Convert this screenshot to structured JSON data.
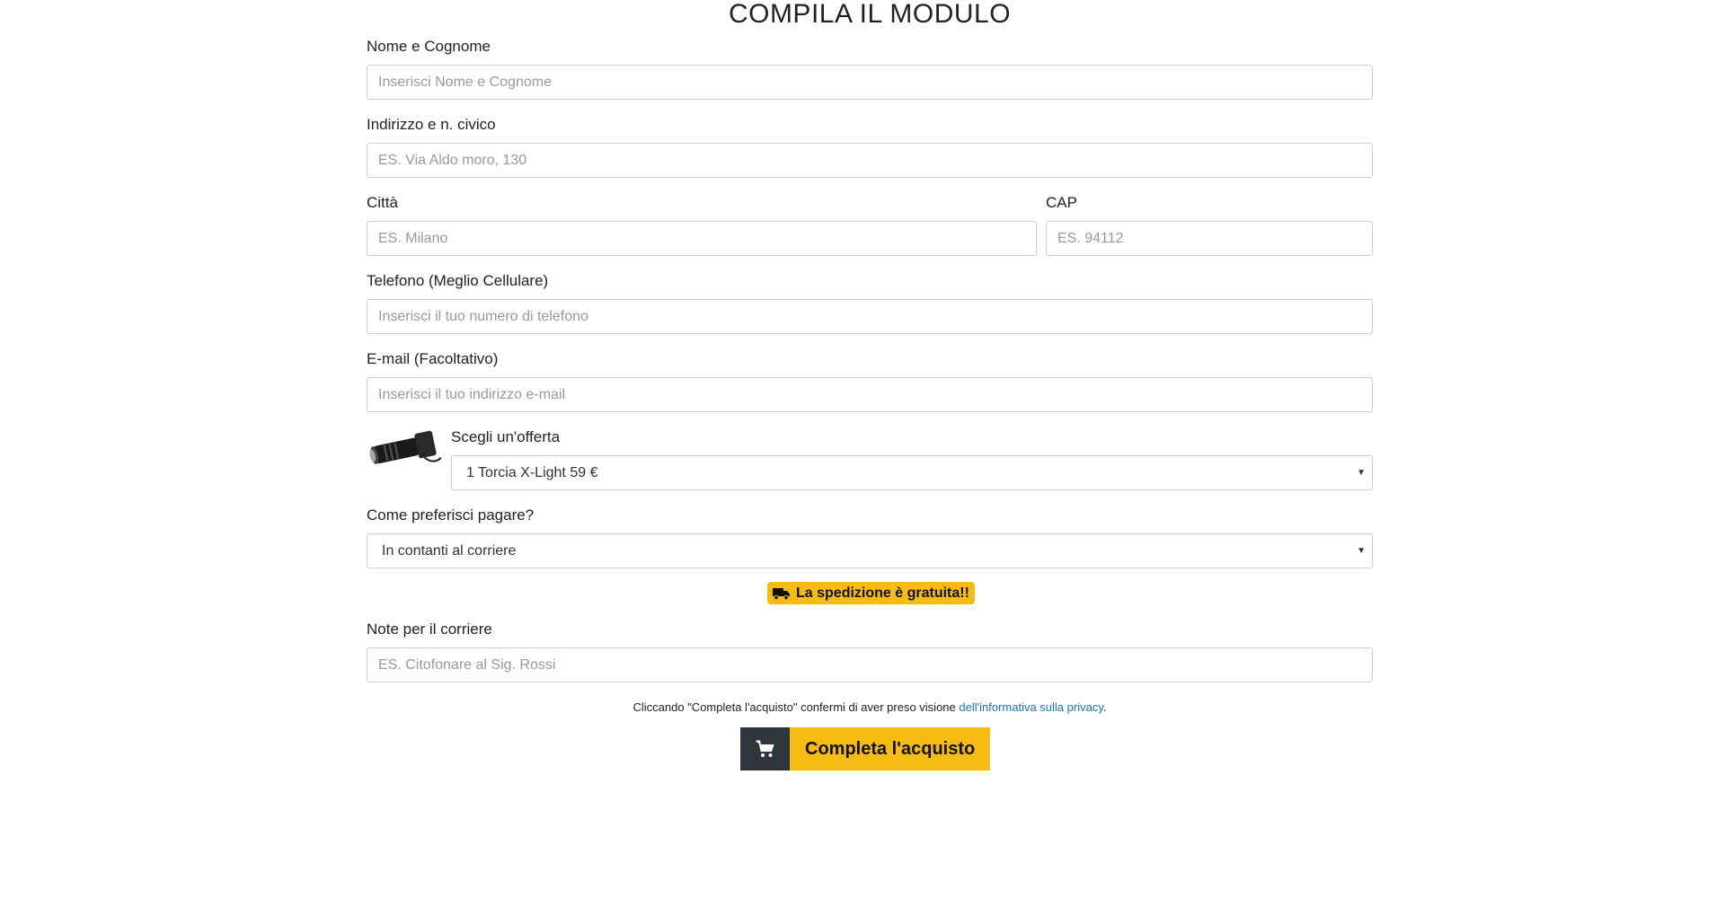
{
  "title": "COMPILA IL MODULO",
  "fields": {
    "name": {
      "label": "Nome e Cognome",
      "placeholder": "Inserisci Nome e Cognome"
    },
    "address": {
      "label": "Indirizzo e n. civico",
      "placeholder": "ES. Via Aldo moro, 130"
    },
    "city": {
      "label": "Città",
      "placeholder": "ES. Milano"
    },
    "cap": {
      "label": "CAP",
      "placeholder": "ES. 94112"
    },
    "phone": {
      "label": "Telefono (Meglio Cellulare)",
      "placeholder": "Inserisci il tuo numero di telefono"
    },
    "email": {
      "label": "E-mail (Facoltativo)",
      "placeholder": "Inserisci il tuo indirizzo e-mail"
    },
    "notes": {
      "label": "Note per il corriere",
      "placeholder": "ES. Citofonare al Sig. Rossi"
    }
  },
  "offer": {
    "label": "Scegli un'offerta",
    "selected": "1 Torcia X-Light 59 €",
    "image": "flashlight-image"
  },
  "payment": {
    "label": "Come preferisci pagare?",
    "selected": "In contanti al corriere"
  },
  "shipping_badge": {
    "text": "La spedizione è gratuita!!",
    "icon": "truck-icon"
  },
  "privacy": {
    "text": "Cliccando \"Completa l'acquisto\" confermi di aver preso visione ",
    "link": "dell'informativa sulla privacy",
    "suffix": "."
  },
  "cta": {
    "label": "Completa l'acquisto",
    "icon": "cart-icon"
  },
  "colors": {
    "accent": "#f7bc12",
    "dark": "#2f353b",
    "link": "#1a73c9"
  }
}
